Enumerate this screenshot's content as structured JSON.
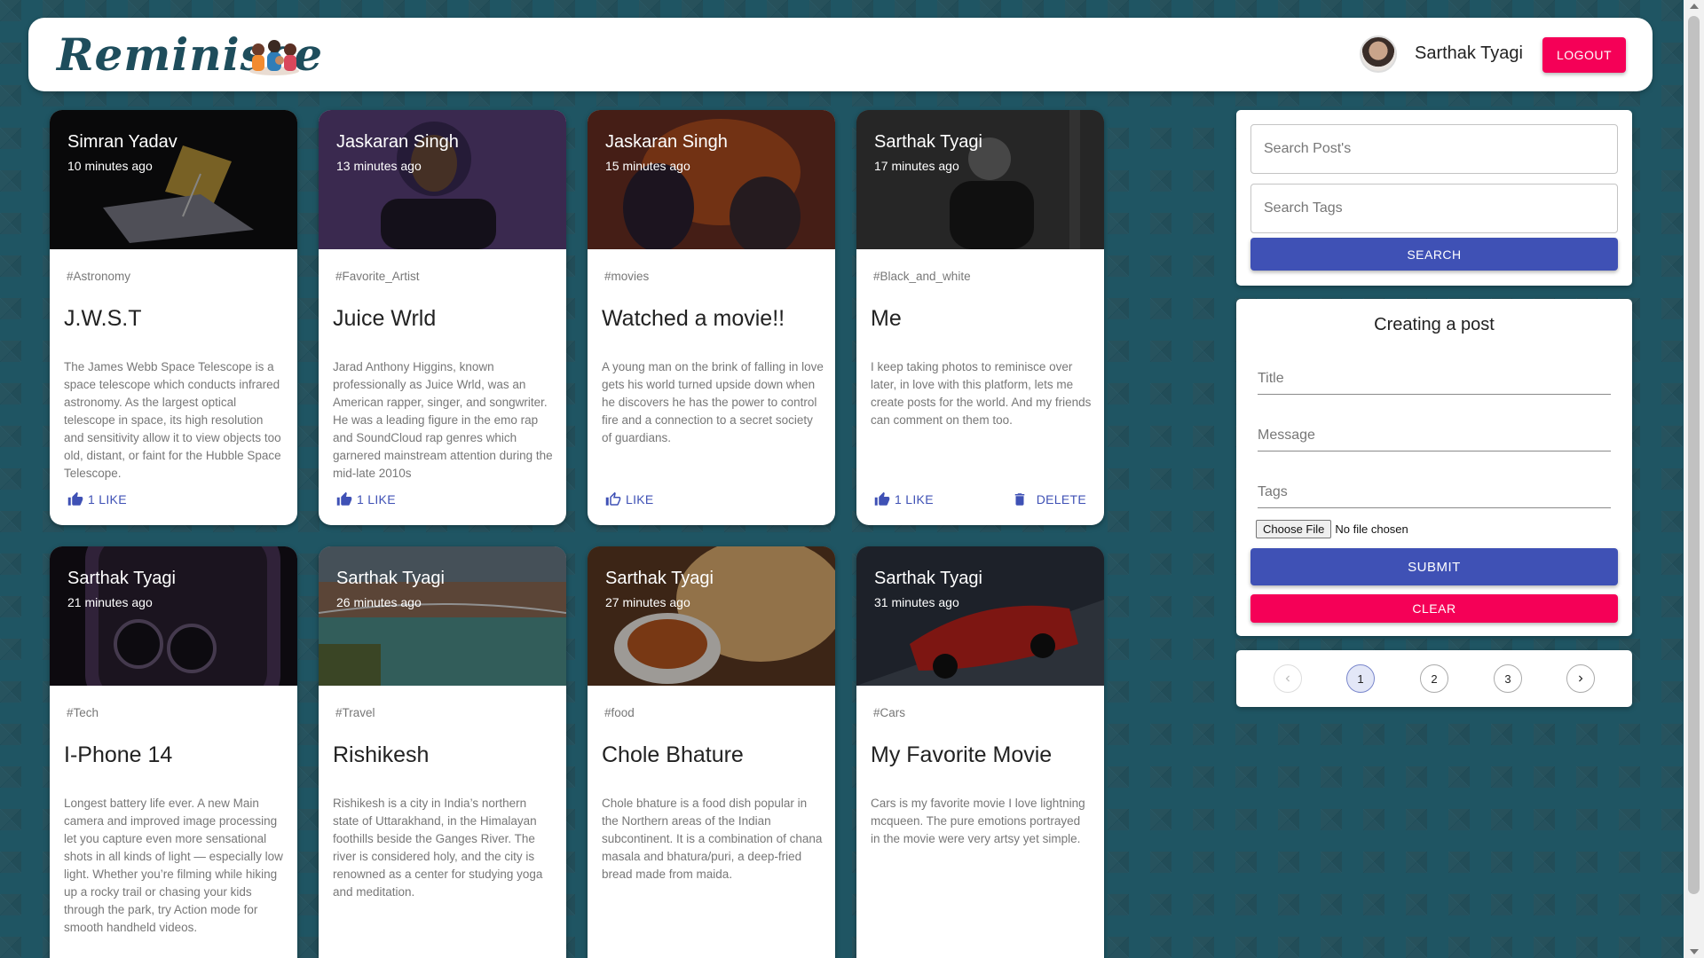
{
  "header": {
    "brand": "Reminisce",
    "user_name": "Sarthak Tyagi",
    "logout_label": "LOGOUT"
  },
  "posts": [
    {
      "author": "Simran Yadav",
      "time": "10 minutes ago",
      "tags": "#Astronomy",
      "title": "J.W.S.T",
      "message": "The James Webb Space Telescope is a space telescope which conducts infrared astronomy. As the largest optical telescope in space, its high resolution and sensitivity allow it to view objects too old, distant, or faint for the Hubble Space Telescope.",
      "like_label": "1 LIKE",
      "image_color": "#1b1b1b"
    },
    {
      "author": "Jaskaran Singh",
      "time": "13 minutes ago",
      "tags": "#Favorite_Artist",
      "title": "Juice Wrld",
      "message": "Jarad Anthony Higgins, known professionally as Juice Wrld, was an American rapper, singer, and songwriter. He was a leading figure in the emo rap and SoundCloud rap genres which garnered mainstream attention during the mid-late 2010s",
      "like_label": "1 LIKE",
      "image_color": "#5a3f7a"
    },
    {
      "author": "Jaskaran Singh",
      "time": "15 minutes ago",
      "tags": "#movies",
      "title": "Watched a movie!!",
      "message": "A young man on the brink of falling in love gets his world turned upside down when he discovers he has the power to control fire and a connection to a secret society of guardians.",
      "like_label": "LIKE",
      "image_color": "#7a3b2a"
    },
    {
      "author": "Sarthak Tyagi",
      "time": "17 minutes ago",
      "tags": "#Black_and_white",
      "title": "Me",
      "message": "I keep taking photos to reminisce over later, in love with this platform, lets me create posts for the world. And my friends can comment on them too.",
      "like_label": "1 LIKE",
      "delete_label": "DELETE",
      "image_color": "#3a3a3a"
    },
    {
      "author": "Sarthak Tyagi",
      "time": "21 minutes ago",
      "tags": "#Tech",
      "title": "I-Phone 14",
      "message": "Longest battery life ever. A new Main camera and improved image processing let you capture even more sensational shots in all kinds of light — especially low light. Whether you’re filming while hiking up a rocky trail or chasing your kids through the park, try Action mode for smooth handheld videos.",
      "image_color": "#2b1f33"
    },
    {
      "author": "Sarthak Tyagi",
      "time": "26 minutes ago",
      "tags": "#Travel",
      "title": "Rishikesh",
      "message": "Rishikesh is a city in India’s northern state of Uttarakhand, in the Himalayan foothills beside the Ganges River. The river is considered holy, and the city is renowned as a center for studying yoga and meditation.",
      "image_color": "#4f6470"
    },
    {
      "author": "Sarthak Tyagi",
      "time": "27 minutes ago",
      "tags": "#food",
      "title": "Chole Bhature",
      "message": "Chole bhature is a food dish popular in the Northern areas of the Indian subcontinent. It is a combination of chana masala and bhatura/puri, a deep-fried bread made from maida.",
      "image_color": "#8a5a34"
    },
    {
      "author": "Sarthak Tyagi",
      "time": "31 minutes ago",
      "tags": "#Cars",
      "title": "My Favorite Movie",
      "message": "Cars is my favorite movie I love lightning mcqueen. The pure emotions portrayed in the movie were very artsy yet simple.",
      "image_color": "#3d4550"
    }
  ],
  "search": {
    "posts_placeholder": "Search Post's",
    "tags_placeholder": "Search Tags",
    "button_label": "SEARCH"
  },
  "form": {
    "title": "Creating a post",
    "title_placeholder": "Title",
    "message_placeholder": "Message",
    "tags_placeholder": "Tags",
    "choose_file_label": "Choose File",
    "no_file_text": "No file chosen",
    "submit_label": "SUBMIT",
    "clear_label": "CLEAR"
  },
  "pagination": {
    "pages": [
      "1",
      "2",
      "3"
    ],
    "current": "1",
    "prev_icon": "chevron-left-icon",
    "next_icon": "chevron-right-icon"
  },
  "colors": {
    "primary": "#3f51b5",
    "secondary": "#f50057",
    "background": "#1f5563"
  }
}
